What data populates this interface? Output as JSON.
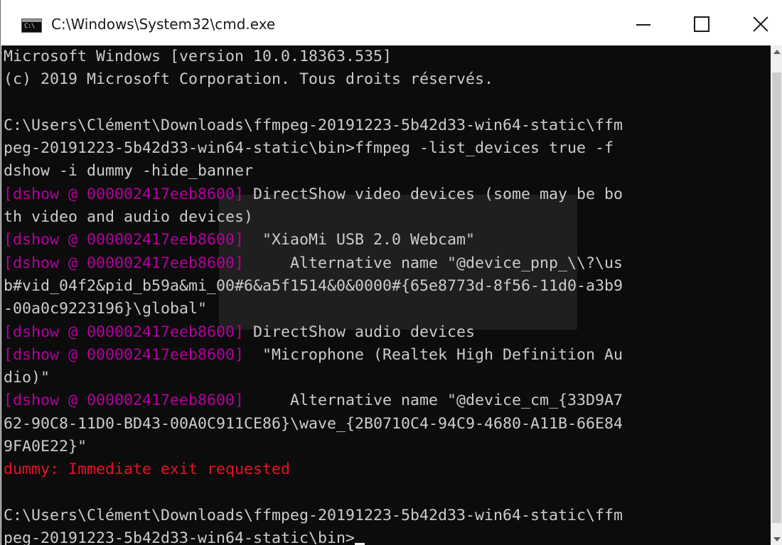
{
  "window": {
    "title": "C:\\Windows\\System32\\cmd.exe",
    "icon_text": "C:\\"
  },
  "colors": {
    "console_bg": "#0c0c0c",
    "text": "#cccccc",
    "tag": "#b4009e",
    "error": "#e81123"
  },
  "console": {
    "lines": [
      {
        "parts": [
          {
            "t": "Microsoft Windows [version 10.0.18363.535]",
            "c": "text"
          }
        ]
      },
      {
        "parts": [
          {
            "t": "(c) 2019 Microsoft Corporation. Tous droits réservés.",
            "c": "text"
          }
        ]
      },
      {
        "parts": [
          {
            "t": "",
            "c": "text"
          }
        ]
      },
      {
        "parts": [
          {
            "t": "C:\\Users\\Clément\\Downloads\\ffmpeg-20191223-5b42d33-win64-static\\ffm",
            "c": "text"
          }
        ]
      },
      {
        "parts": [
          {
            "t": "peg-20191223-5b42d33-win64-static\\bin>ffmpeg -list_devices true -f",
            "c": "text"
          }
        ]
      },
      {
        "parts": [
          {
            "t": "dshow -i dummy -hide_banner",
            "c": "text"
          }
        ]
      },
      {
        "parts": [
          {
            "t": "[dshow @ 000002417eeb8600]",
            "c": "tag"
          },
          {
            "t": " DirectShow video devices (some may be bo",
            "c": "text"
          }
        ]
      },
      {
        "parts": [
          {
            "t": "th video and audio devices)",
            "c": "text"
          }
        ]
      },
      {
        "parts": [
          {
            "t": "[dshow @ 000002417eeb8600]",
            "c": "tag"
          },
          {
            "t": "  \"XiaoMi USB 2.0 Webcam\"",
            "c": "text"
          }
        ]
      },
      {
        "parts": [
          {
            "t": "[dshow @ 000002417eeb8600]",
            "c": "tag"
          },
          {
            "t": "     Alternative name \"@device_pnp_\\\\?\\us",
            "c": "text"
          }
        ]
      },
      {
        "parts": [
          {
            "t": "b#vid_04f2&pid_b59a&mi_00#6&a5f1514&0&0000#{65e8773d-8f56-11d0-a3b9",
            "c": "text"
          }
        ]
      },
      {
        "parts": [
          {
            "t": "-00a0c9223196}\\global\"",
            "c": "text"
          }
        ]
      },
      {
        "parts": [
          {
            "t": "[dshow @ 000002417eeb8600]",
            "c": "tag"
          },
          {
            "t": " DirectShow audio devices",
            "c": "text"
          }
        ]
      },
      {
        "parts": [
          {
            "t": "[dshow @ 000002417eeb8600]",
            "c": "tag"
          },
          {
            "t": "  \"Microphone (Realtek High Definition Au",
            "c": "text"
          }
        ]
      },
      {
        "parts": [
          {
            "t": "dio)\"",
            "c": "text"
          }
        ]
      },
      {
        "parts": [
          {
            "t": "[dshow @ 000002417eeb8600]",
            "c": "tag"
          },
          {
            "t": "     Alternative name \"@device_cm_{33D9A7",
            "c": "text"
          }
        ]
      },
      {
        "parts": [
          {
            "t": "62-90C8-11D0-BD43-00A0C911CE86}\\wave_{2B0710C4-94C9-4680-A11B-66E84",
            "c": "text"
          }
        ]
      },
      {
        "parts": [
          {
            "t": "9FA0E22}\"",
            "c": "text"
          }
        ]
      },
      {
        "parts": [
          {
            "t": "dummy: Immediate exit requested",
            "c": "error"
          }
        ]
      },
      {
        "parts": [
          {
            "t": "",
            "c": "text"
          }
        ]
      },
      {
        "parts": [
          {
            "t": "C:\\Users\\Clément\\Downloads\\ffmpeg-20191223-5b42d33-win64-static\\ffm",
            "c": "text"
          }
        ]
      },
      {
        "parts": [
          {
            "t": "peg-20191223-5b42d33-win64-static\\bin>",
            "c": "text"
          }
        ],
        "cursor": true
      }
    ]
  }
}
